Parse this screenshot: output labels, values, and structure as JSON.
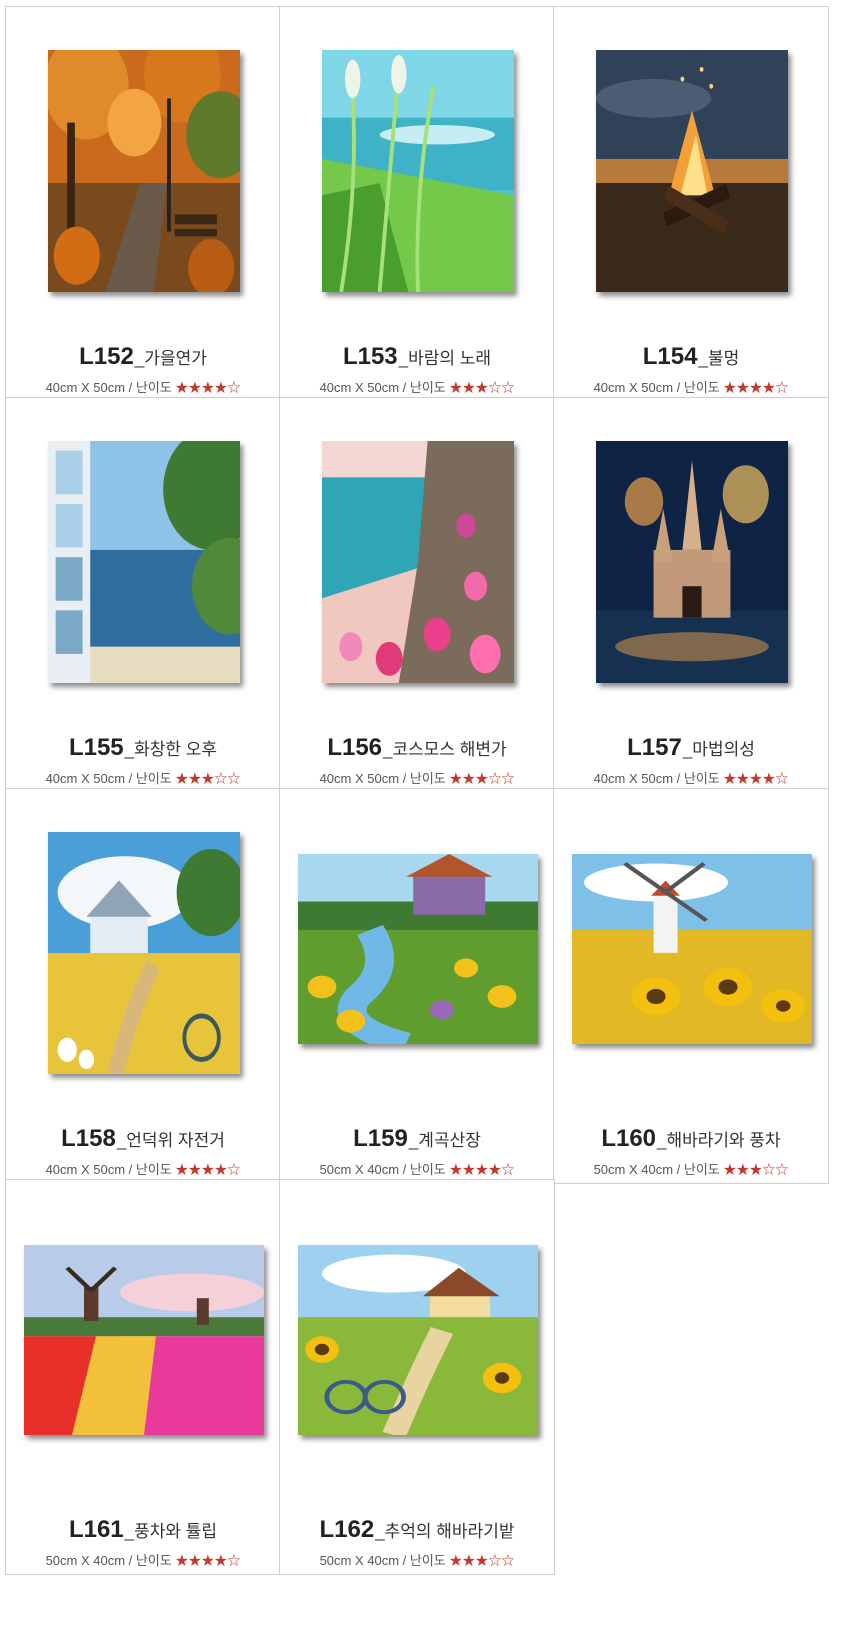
{
  "products": [
    {
      "code": "L152",
      "name": "_가을연가",
      "size": "40cm X 50cm",
      "difficulty_label": "난이도",
      "stars": "★★★★☆",
      "rating": 4,
      "orientation": "portrait",
      "scene": "autumn-path",
      "scene_name": "autumn-park-painting"
    },
    {
      "code": "L153",
      "name": "_바람의 노래",
      "size": "40cm X 50cm",
      "difficulty_label": "난이도",
      "stars": "★★★☆☆",
      "rating": 3,
      "orientation": "portrait",
      "scene": "sea-grass",
      "scene_name": "seaside-grass-painting"
    },
    {
      "code": "L154",
      "name": "_불멍",
      "size": "40cm X 50cm",
      "difficulty_label": "난이도",
      "stars": "★★★★☆",
      "rating": 4,
      "orientation": "portrait",
      "scene": "campfire",
      "scene_name": "campfire-painting"
    },
    {
      "code": "L155",
      "name": "_화창한 오후",
      "size": "40cm X 50cm",
      "difficulty_label": "난이도",
      "stars": "★★★☆☆",
      "rating": 3,
      "orientation": "portrait",
      "scene": "window-sea",
      "scene_name": "window-sea-painting"
    },
    {
      "code": "L156",
      "name": "_코스모스 해변가",
      "size": "40cm X 50cm",
      "difficulty_label": "난이도",
      "stars": "★★★☆☆",
      "rating": 3,
      "orientation": "portrait",
      "scene": "cosmos-beach",
      "scene_name": "cosmos-beach-painting"
    },
    {
      "code": "L157",
      "name": "_마법의성",
      "size": "40cm X 50cm",
      "difficulty_label": "난이도",
      "stars": "★★★★☆",
      "rating": 4,
      "orientation": "portrait",
      "scene": "castle",
      "scene_name": "castle-fireworks-painting"
    },
    {
      "code": "L158",
      "name": "_언덕위 자전거",
      "size": "40cm X 50cm",
      "difficulty_label": "난이도",
      "stars": "★★★★☆",
      "rating": 4,
      "orientation": "portrait",
      "scene": "hill-bike",
      "scene_name": "hill-bicycle-painting"
    },
    {
      "code": "L159",
      "name": "_계곡산장",
      "size": "50cm X 40cm",
      "difficulty_label": "난이도",
      "stars": "★★★★☆",
      "rating": 4,
      "orientation": "landscape",
      "scene": "valley-cabin",
      "scene_name": "valley-cabin-painting"
    },
    {
      "code": "L160",
      "name": "_해바라기와 풍차",
      "size": "50cm X 40cm",
      "difficulty_label": "난이도",
      "stars": "★★★☆☆",
      "rating": 3,
      "orientation": "landscape",
      "scene": "sunflower-windmill",
      "scene_name": "sunflower-windmill-painting"
    },
    {
      "code": "L161",
      "name": "_풍차와 튤립",
      "size": "50cm X 40cm",
      "difficulty_label": "난이도",
      "stars": "★★★★☆",
      "rating": 4,
      "orientation": "landscape",
      "scene": "tulip-windmill",
      "scene_name": "tulip-windmill-painting"
    },
    {
      "code": "L162",
      "name": "_추억의 해바라기밭",
      "size": "50cm X 40cm",
      "difficulty_label": "난이도",
      "stars": "★★★☆☆",
      "rating": 3,
      "orientation": "landscape",
      "scene": "sunflower-path",
      "scene_name": "sunflower-path-painting"
    }
  ],
  "colors": {
    "border": "#cfcfcf",
    "star": "#c0392b",
    "title": "#222222",
    "meta": "#555555"
  }
}
